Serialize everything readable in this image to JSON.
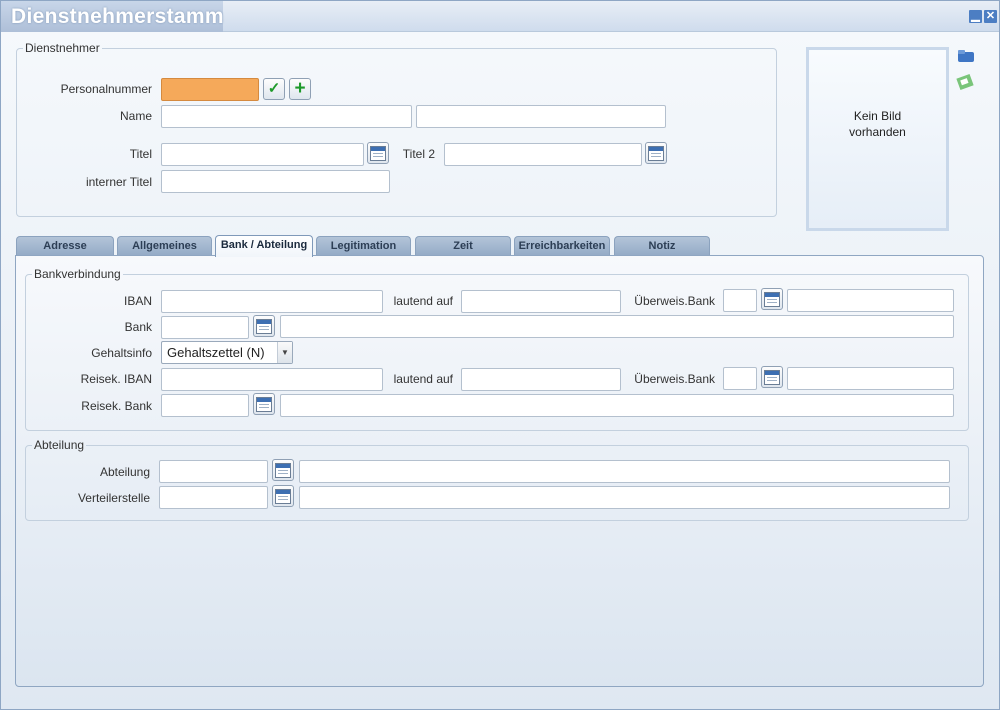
{
  "window": {
    "title": "Dienstnehmerstamm",
    "minimize": "▁",
    "close": "✕"
  },
  "dienstnehmer": {
    "legend": "Dienstnehmer",
    "personalnummer_label": "Personalnummer",
    "personalnummer_value": "",
    "name_label": "Name",
    "name_first": "",
    "name_last": "",
    "titel_label": "Titel",
    "titel_value": "",
    "titel2_label": "Titel 2",
    "titel2_value": "",
    "interner_titel_label": "interner Titel",
    "interner_titel_value": ""
  },
  "photo": {
    "line1": "Kein Bild",
    "line2": "vorhanden"
  },
  "tabs": [
    {
      "label": "Adresse"
    },
    {
      "label": "Allgemeines"
    },
    {
      "label": "Bank / Abteilung",
      "active": true
    },
    {
      "label": "Legitimation"
    },
    {
      "label": "Zeit"
    },
    {
      "label": "Erreichbarkeiten"
    },
    {
      "label": "Notiz"
    }
  ],
  "bank": {
    "legend": "Bankverbindung",
    "iban_label": "IBAN",
    "lautend_label": "lautend auf",
    "ueberweis_label": "Überweis.Bank",
    "bank_label": "Bank",
    "gehaltsinfo_label": "Gehaltsinfo",
    "gehaltsinfo_value": "Gehaltszettel (N)",
    "reisek_iban_label": "Reisek. IBAN",
    "reisek_lautend_label": "lautend auf",
    "reisek_ueberweis_label": "Überweis.Bank",
    "reisek_bank_label": "Reisek. Bank"
  },
  "abteilung": {
    "legend": "Abteilung",
    "abteilung_label": "Abteilung",
    "verteilerstelle_label": "Verteilerstelle"
  }
}
